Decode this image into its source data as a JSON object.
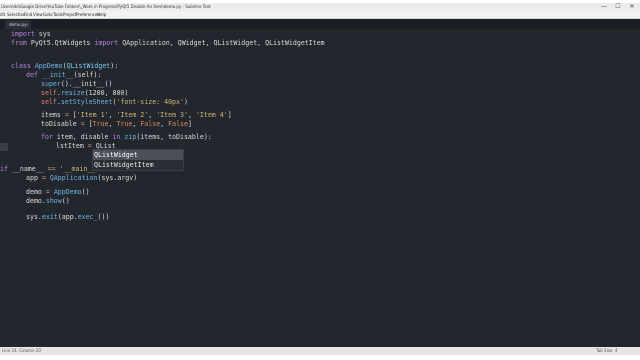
{
  "window": {
    "title": "Users\\de\\Google Drive\\YouTube Folders\\_Work in Progress\\PyQt5 Disable An Item\\demo.py - Sublime Text",
    "minimize_glyph": "—",
    "maximize_glyph": "☐",
    "close_glyph": "✕"
  },
  "menu": [
    "dit",
    "Selection",
    "Find",
    "View",
    "Goto",
    "Tools",
    "Project",
    "Preferences",
    "Help"
  ],
  "tab": {
    "label": "demo.py",
    "close_glyph": "×"
  },
  "code": {
    "l1": {
      "kw": "import",
      "rest": " sys"
    },
    "l2": {
      "kw1": "from",
      "mod": " PyQt5.QtWidgets ",
      "kw2": "import",
      "rest": " QApplication, QWidget, QListWidget, QListWidgetItem"
    },
    "l4": {
      "kw": "class",
      "name": " AppDemo",
      "p1": "(",
      "base": "QListWidget",
      "p2": "):"
    },
    "l5": {
      "kw": "def",
      "name": " __init__",
      "rest": "(self):"
    },
    "l6": {
      "fn": "super",
      "rest": "().__init__()"
    },
    "l7": {
      "self": "self",
      "dot": ".",
      "fn": "resize",
      "rest": "(1200, 800)"
    },
    "l8": {
      "self": "self",
      "dot": ".",
      "fn": "setStyleSheet",
      "p1": "(",
      "str": "'font-size: 40px'",
      "p2": ")"
    },
    "l10": {
      "a": "items ",
      "eq": "=",
      "b": " [",
      "s1": "'Item 1'",
      "c1": ", ",
      "s2": "'Item 2'",
      "c2": ", ",
      "s3": "'Item 3'",
      "c3": ", ",
      "s4": "'Item 4'",
      "e": "]"
    },
    "l11": {
      "a": "toDisable ",
      "eq": "=",
      "b": " [",
      "v1": "True",
      "c1": ", ",
      "v2": "True",
      "c2": ", ",
      "v3": "False",
      "c3": ", ",
      "v4": "False",
      "e": "]"
    },
    "l13": {
      "kw1": "for",
      "a": " item, disable ",
      "kw2": "in",
      "sp": " ",
      "fn": "zip",
      "rest": "(items, toDisable):"
    },
    "l14": {
      "a": "lstItem ",
      "eq": "=",
      "b": " QList"
    },
    "l16": {
      "kw": "if",
      "a": " __name__ ",
      "eq": "==",
      "sp": " ",
      "str": "'__main__'",
      "e": ":"
    },
    "l17": {
      "a": "app ",
      "eq": "=",
      "sp": " ",
      "cls": "QApplication",
      "rest": "(sys.argv)"
    },
    "l19": {
      "a": "demo ",
      "eq": "=",
      "sp": " ",
      "cls": "AppDemo",
      "rest": "()"
    },
    "l20": {
      "a": "demo.",
      "fn": "show",
      "rest": "()"
    },
    "l22": {
      "a": "sys.",
      "fn": "exit",
      "b": "(app.",
      "fn2": "exec_",
      "rest": "())"
    }
  },
  "autocomplete": [
    "QListWidget",
    "QListWidgetItem"
  ],
  "status": {
    "left": "Line 14, Column 20",
    "right": "Tab Size: 4"
  },
  "colors": {
    "editor_bg": "#22262d",
    "keyword": "#b583e0",
    "function": "#6fb3e3",
    "string": "#d0b772",
    "boolean": "#d98c5f"
  }
}
